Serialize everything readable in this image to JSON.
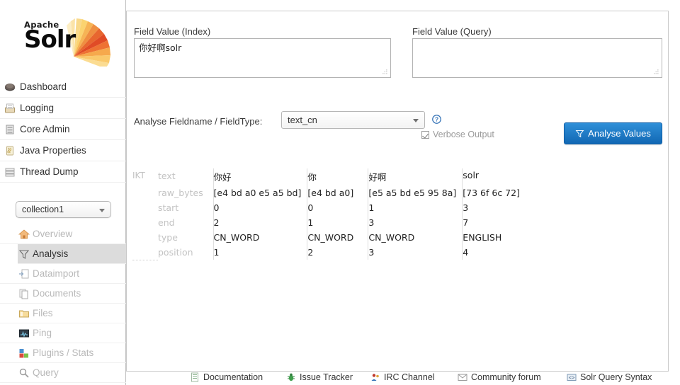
{
  "branding": {
    "apache": "Apache",
    "product": "Solr",
    "logo_icon": "solr-fan-logo"
  },
  "sidebar": {
    "top_items": [
      {
        "label": "Dashboard",
        "icon": "dashboard-icon"
      },
      {
        "label": "Logging",
        "icon": "logging-icon"
      },
      {
        "label": "Core Admin",
        "icon": "core-admin-icon"
      },
      {
        "label": "Java Properties",
        "icon": "java-properties-icon"
      },
      {
        "label": "Thread Dump",
        "icon": "thread-dump-icon"
      }
    ],
    "core_selector": {
      "value": "collection1",
      "icon": "chevron-down-icon"
    },
    "core_items": [
      {
        "label": "Overview",
        "icon": "overview-home-icon",
        "active": false
      },
      {
        "label": "Analysis",
        "icon": "analysis-funnel-icon",
        "active": true
      },
      {
        "label": "Dataimport",
        "icon": "dataimport-icon",
        "active": false
      },
      {
        "label": "Documents",
        "icon": "documents-icon",
        "active": false
      },
      {
        "label": "Files",
        "icon": "files-folder-icon",
        "active": false
      },
      {
        "label": "Ping",
        "icon": "ping-icon",
        "active": false
      },
      {
        "label": "Plugins / Stats",
        "icon": "plugins-stats-icon",
        "active": false
      },
      {
        "label": "Query",
        "icon": "query-magnifier-icon",
        "active": false
      }
    ]
  },
  "main": {
    "index_field": {
      "label": "Field Value (Index)",
      "value": "你好啊solr",
      "placeholder": ""
    },
    "query_field": {
      "label": "Field Value (Query)",
      "value": "",
      "placeholder": ""
    },
    "analyse_label": "Analyse Fieldname / FieldType:",
    "fieldtype_select": {
      "value": "text_cn",
      "icon": "chevron-down-icon"
    },
    "help_icon": "help-question-icon",
    "verbose": {
      "label": "Verbose Output",
      "checked": true
    },
    "analyse_button": {
      "label": "Analyse Values",
      "icon": "funnel-icon",
      "color": "#1877c9"
    }
  },
  "analysis": {
    "analyzer_abbr": "IKT",
    "row_labels": [
      "text",
      "raw_bytes",
      "start",
      "end",
      "type",
      "position"
    ],
    "tokens": [
      {
        "text": "你好",
        "raw_bytes": "[e4 bd a0 e5 a5 bd]",
        "start": "0",
        "end": "2",
        "type": "CN_WORD",
        "position": "1"
      },
      {
        "text": "你",
        "raw_bytes": "[e4 bd a0]",
        "start": "0",
        "end": "1",
        "type": "CN_WORD",
        "position": "2"
      },
      {
        "text": "好啊",
        "raw_bytes": "[e5 a5 bd e5 95 8a]",
        "start": "1",
        "end": "3",
        "type": "CN_WORD",
        "position": "3"
      },
      {
        "text": "solr",
        "raw_bytes": "[73 6f 6c 72]",
        "start": "3",
        "end": "7",
        "type": "ENGLISH",
        "position": "4"
      }
    ]
  },
  "footer": {
    "links": [
      {
        "label": "Documentation",
        "icon": "document-icon"
      },
      {
        "label": "Issue Tracker",
        "icon": "bug-icon"
      },
      {
        "label": "IRC Channel",
        "icon": "irc-people-icon"
      },
      {
        "label": "Community forum",
        "icon": "mail-icon"
      },
      {
        "label": "Solr Query Syntax",
        "icon": "syntax-icon"
      }
    ]
  }
}
